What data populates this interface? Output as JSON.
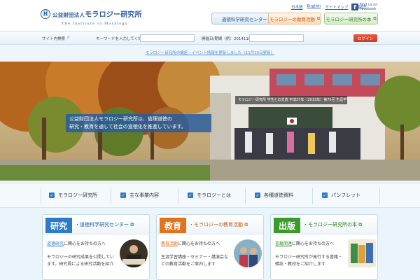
{
  "header": {
    "logo_mark": "Ⓜ",
    "logo_prefix": "公益財団法人",
    "logo_title": "モラロジー研究所",
    "logo_sub": "The Institute of Moralogy",
    "links": [
      "日本語",
      "English",
      "サイトマップ",
      "English"
    ],
    "facebook": {
      "line1": "Find us on",
      "line2": "Facebook"
    },
    "nav": [
      {
        "label": "道徳科学研究センター",
        "arrow": "⧉"
      },
      {
        "label": "モラロジーの教育活動",
        "arrow": "⧉"
      },
      {
        "label": "モラロジー研究所の本",
        "arrow": "⧉"
      }
    ]
  },
  "search": {
    "site_search_label": "サイト内検索",
    "keyword_label": "キーワードを入力してください（例：モラロジー）",
    "date_label": "開催日/期間（例：20141107）",
    "login_label": "ログイン"
  },
  "notice": {
    "text": "モラロジー研究所の講座・イベント情報を更新しました（11月15日更新）"
  },
  "hero": {
    "text_line1": "公益財団法人モラロジー研究所は、倫理道徳の",
    "text_line2": "研究・教育を通して社会の道徳化を推進しています。",
    "caption": "モラロジー研究所 学生との交流 平成27年（2015年）第75回 生涯学習"
  },
  "menu": [
    {
      "label": "モラロジー研究所"
    },
    {
      "label": "主な事業内容"
    },
    {
      "label": "モラロジーとは"
    },
    {
      "label": "各種道徳資料"
    },
    {
      "label": "パンフレット"
    }
  ],
  "cards": [
    {
      "tag": "研究",
      "title": "・道徳科学研究センター",
      "sub_hl": "道徳研究",
      "sub_rest": "に関心をお持ちの方へ",
      "desc": "モラロジーの研究成果を公開しています。研究員による研究活動を紹介",
      "color": "#2d7ac8"
    },
    {
      "tag": "教育",
      "title": "・モラロジーの教育活動",
      "sub_hl": "教育活動",
      "sub_rest": "に関心をお持ちの方へ",
      "desc": "生涯学習講座・セミナー・講演会などの教育活動をご案内します",
      "color": "#e0731c"
    },
    {
      "tag": "出版",
      "title": "・モラロジー研究所の本",
      "sub_hl": "書籍関連",
      "sub_rest": "に関心をお持ちの方へ",
      "desc": "モラロジー研究所が発行する書籍・雑誌・教材をご紹介します",
      "color": "#3a9b2a"
    }
  ],
  "colors": {
    "brand_blue": "#2b5fa8",
    "research": "#2d7ac8",
    "education": "#e0731c",
    "publishing": "#3a9b2a"
  }
}
